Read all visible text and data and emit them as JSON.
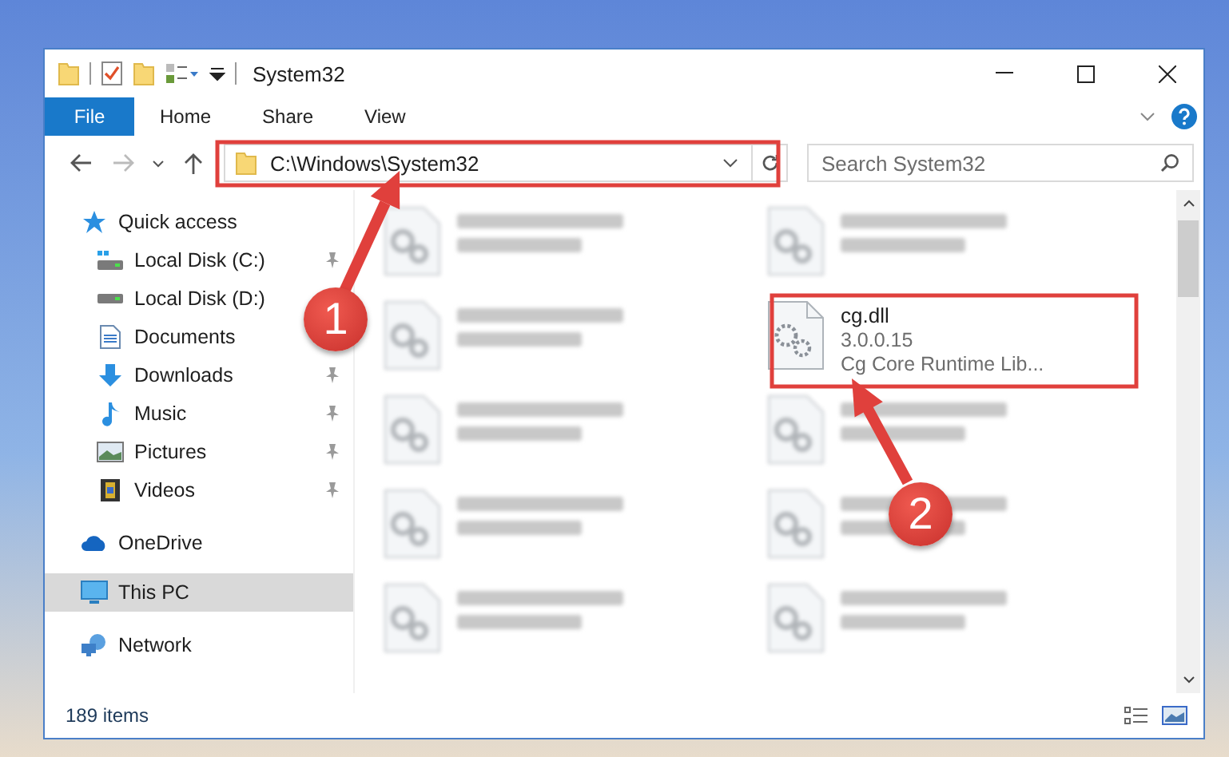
{
  "window": {
    "title": "System32"
  },
  "ribbon": {
    "tabs": [
      {
        "label": "File",
        "selected": true
      },
      {
        "label": "Home",
        "selected": false
      },
      {
        "label": "Share",
        "selected": false
      },
      {
        "label": "View",
        "selected": false
      }
    ]
  },
  "address_bar": {
    "path": "C:\\Windows\\System32"
  },
  "search": {
    "placeholder": "Search System32"
  },
  "navigation": {
    "items": [
      {
        "label": "Quick access",
        "selected": false,
        "children": [
          {
            "label": "Local Disk (C:)",
            "pinned": true,
            "selected": false
          },
          {
            "label": "Local Disk (D:)",
            "selected": false
          },
          {
            "label": "Documents",
            "selected": false
          },
          {
            "label": "Downloads",
            "pinned": true,
            "selected": false
          },
          {
            "label": "Music",
            "pinned": true,
            "selected": false
          },
          {
            "label": "Pictures",
            "pinned": true,
            "selected": false
          },
          {
            "label": "Videos",
            "pinned": true,
            "selected": false
          }
        ]
      },
      {
        "label": "OneDrive",
        "selected": false
      },
      {
        "label": "This PC",
        "selected": true
      },
      {
        "label": "Network",
        "selected": false
      }
    ]
  },
  "files": [
    {
      "kind": "blurred"
    },
    {
      "kind": "blurred"
    },
    {
      "kind": "blurred"
    },
    {
      "kind": "file",
      "name": "cg.dll",
      "details": [
        "3.0.0.15",
        "Cg Core Runtime Lib..."
      ]
    },
    {
      "kind": "blurred"
    },
    {
      "kind": "blurred"
    },
    {
      "kind": "blurred"
    },
    {
      "kind": "blurred"
    },
    {
      "kind": "blurred"
    },
    {
      "kind": "blurred"
    }
  ],
  "status_bar": {
    "text": "189 items"
  },
  "annotations": [
    {
      "label": "1"
    },
    {
      "label": "2"
    }
  ]
}
